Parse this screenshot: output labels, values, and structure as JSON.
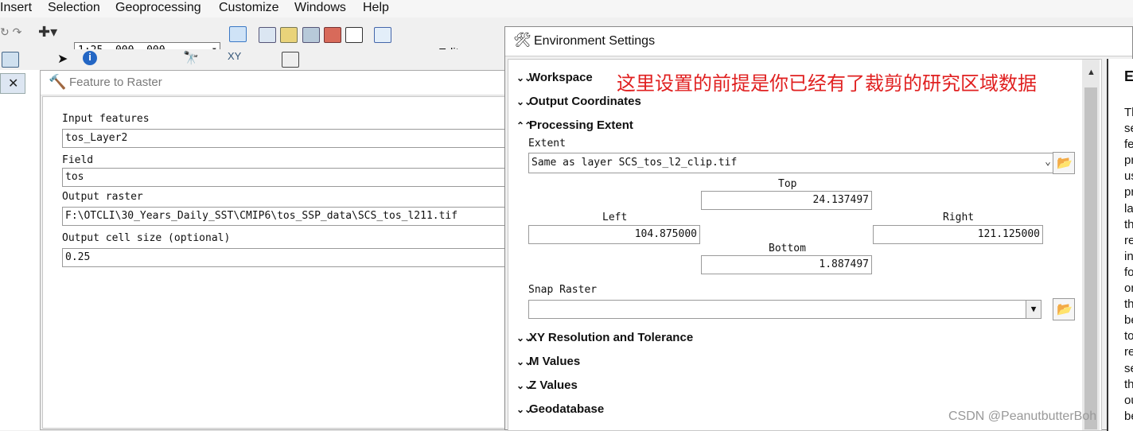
{
  "menubar": [
    "Insert",
    "Selection",
    "Geoprocessing",
    "Customize",
    "Windows",
    "Help"
  ],
  "toolbar": {
    "scale": "1:25, 000, 000",
    "editor_label": "Editor"
  },
  "feature_to_raster": {
    "title": "Feature to Raster",
    "labels": {
      "input_features": "Input features",
      "field": "Field",
      "output_raster": "Output raster",
      "output_cell_size": "Output cell size (optional)"
    },
    "values": {
      "input_features": "tos_Layer2",
      "field": "tos",
      "output_raster": "F:\\OTCLI\\30_Years_Daily_SST\\CMIP6\\tos_SSP_data\\SCS_tos_l211.tif",
      "output_cell_size": "0.25"
    }
  },
  "environment_settings": {
    "title": "Environment Settings",
    "sections": {
      "workspace": "Workspace",
      "output_coordinates": "Output Coordinates",
      "processing_extent": "Processing Extent",
      "xy_resolution": "XY Resolution and Tolerance",
      "m_values": "M Values",
      "z_values": "Z Values",
      "geodatabase": "Geodatabase"
    },
    "extent": {
      "label": "Extent",
      "value": "Same as layer SCS_tos_l2_clip.tif",
      "top_label": "Top",
      "top": "24.137497",
      "left_label": "Left",
      "left": "104.875000",
      "right_label": "Right",
      "right": "121.125000",
      "bottom_label": "Bottom",
      "bottom": "1.887497"
    },
    "snap_raster": {
      "label": "Snap Raster",
      "value": ""
    },
    "annotation": "这里设置的前提是你已经有了裁剪的研究区域数据"
  },
  "help_panel": {
    "heading": "E",
    "column_letters": [
      "Th",
      "se",
      "fe",
      "pr",
      "us",
      "pr",
      "la",
      "th",
      "re",
      "in",
      "fo",
      "or",
      "th",
      "be",
      "to",
      "re",
      "se",
      "th",
      "ou",
      "be"
    ]
  },
  "watermark": "CSDN @PeanutbutterBoh",
  "colors": {
    "annotation": "#e02020",
    "title_text": "#7a7a7a"
  }
}
